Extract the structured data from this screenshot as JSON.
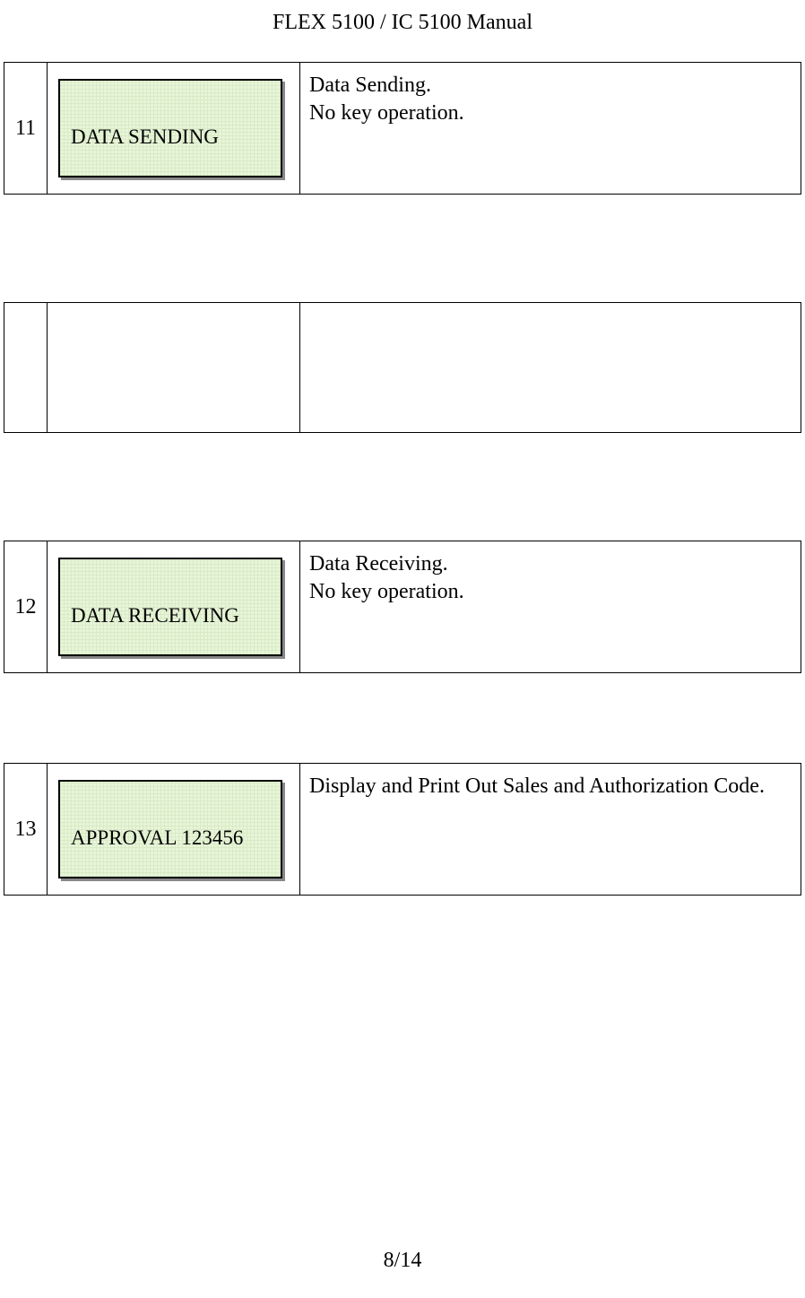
{
  "header": {
    "title": "FLEX 5100 / IC 5100 Manual"
  },
  "rows": [
    {
      "num": "11",
      "display": "DATA SENDING",
      "desc_line1": "Data Sending.",
      "desc_line2": "No key operation."
    },
    {
      "num": "",
      "display": "",
      "desc_line1": "",
      "desc_line2": ""
    },
    {
      "num": "12",
      "display": "DATA RECEIVING",
      "desc_line1": "Data Receiving.",
      "desc_line2": "No key operation."
    },
    {
      "num": "13",
      "display": "APPROVAL 123456",
      "desc_line1": "Display and Print Out Sales and Authorization Code.",
      "desc_line2": ""
    }
  ],
  "footer": {
    "page": "8/14"
  }
}
